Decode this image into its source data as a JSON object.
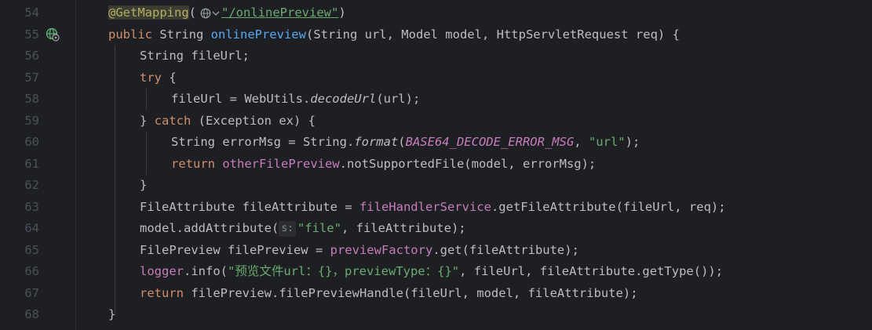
{
  "gutter": {
    "line_numbers": [
      "54",
      "55",
      "56",
      "57",
      "58",
      "59",
      "60",
      "61",
      "62",
      "63",
      "64",
      "65",
      "66",
      "67",
      "68"
    ]
  },
  "code": {
    "l54": {
      "annotation": "@GetMapping",
      "open": "(",
      "url": "\"/onlinePreview\"",
      "close": ")"
    },
    "l55": {
      "kw": "public",
      "type": " String ",
      "method": "onlinePreview",
      "params": "(String url, Model model, HttpServletRequest req) {"
    },
    "l56": {
      "text": "String fileUrl;"
    },
    "l57": {
      "kw": "try",
      "rest": " {"
    },
    "l58": {
      "pre": "fileUrl = WebUtils.",
      "call": "decodeUrl",
      "post": "(url);"
    },
    "l59": {
      "pre": "} ",
      "kw": "catch",
      "post": " (Exception ex) {"
    },
    "l60": {
      "pre": "String errorMsg = String.",
      "call": "format",
      "open": "(",
      "const": "BASE64_DECODE_ERROR_MSG",
      "sep": ", ",
      "str": "\"url\"",
      "post": ");"
    },
    "l61": {
      "kw": "return",
      "sp": " ",
      "field": "otherFilePreview",
      "post": ".notSupportedFile(model, errorMsg);"
    },
    "l62": {
      "text": "}"
    },
    "l63": {
      "pre": "FileAttribute fileAttribute = ",
      "field": "fileHandlerService",
      "post": ".getFileAttribute(fileUrl, req);"
    },
    "l64": {
      "pre": "model.addAttribute(",
      "hint": "s:",
      "str": "\"file\"",
      "post": ", fileAttribute);"
    },
    "l65": {
      "pre": "FilePreview filePreview = ",
      "field": "previewFactory",
      "post": ".get(fileAttribute);"
    },
    "l66": {
      "field": "logger",
      "pre": ".info(",
      "str": "\"预览文件url：{}，previewType：{}\"",
      "post": ", fileUrl, fileAttribute.getType());"
    },
    "l67": {
      "kw": "return",
      "post": " filePreview.filePreviewHandle(fileUrl, model, fileAttribute);"
    },
    "l68": {
      "text": "}"
    }
  },
  "icons": {
    "gutter_icon": "web-endpoint-globe-icon",
    "inline_hint_icon": "globe-icon"
  },
  "colors": {
    "background": "#1e1f22",
    "keyword": "#cf8e6d",
    "string": "#6aab73",
    "method_declaration": "#56a8f5",
    "field": "#c77dbb",
    "annotation": "#b3ae60",
    "line_number": "#4b5059"
  }
}
